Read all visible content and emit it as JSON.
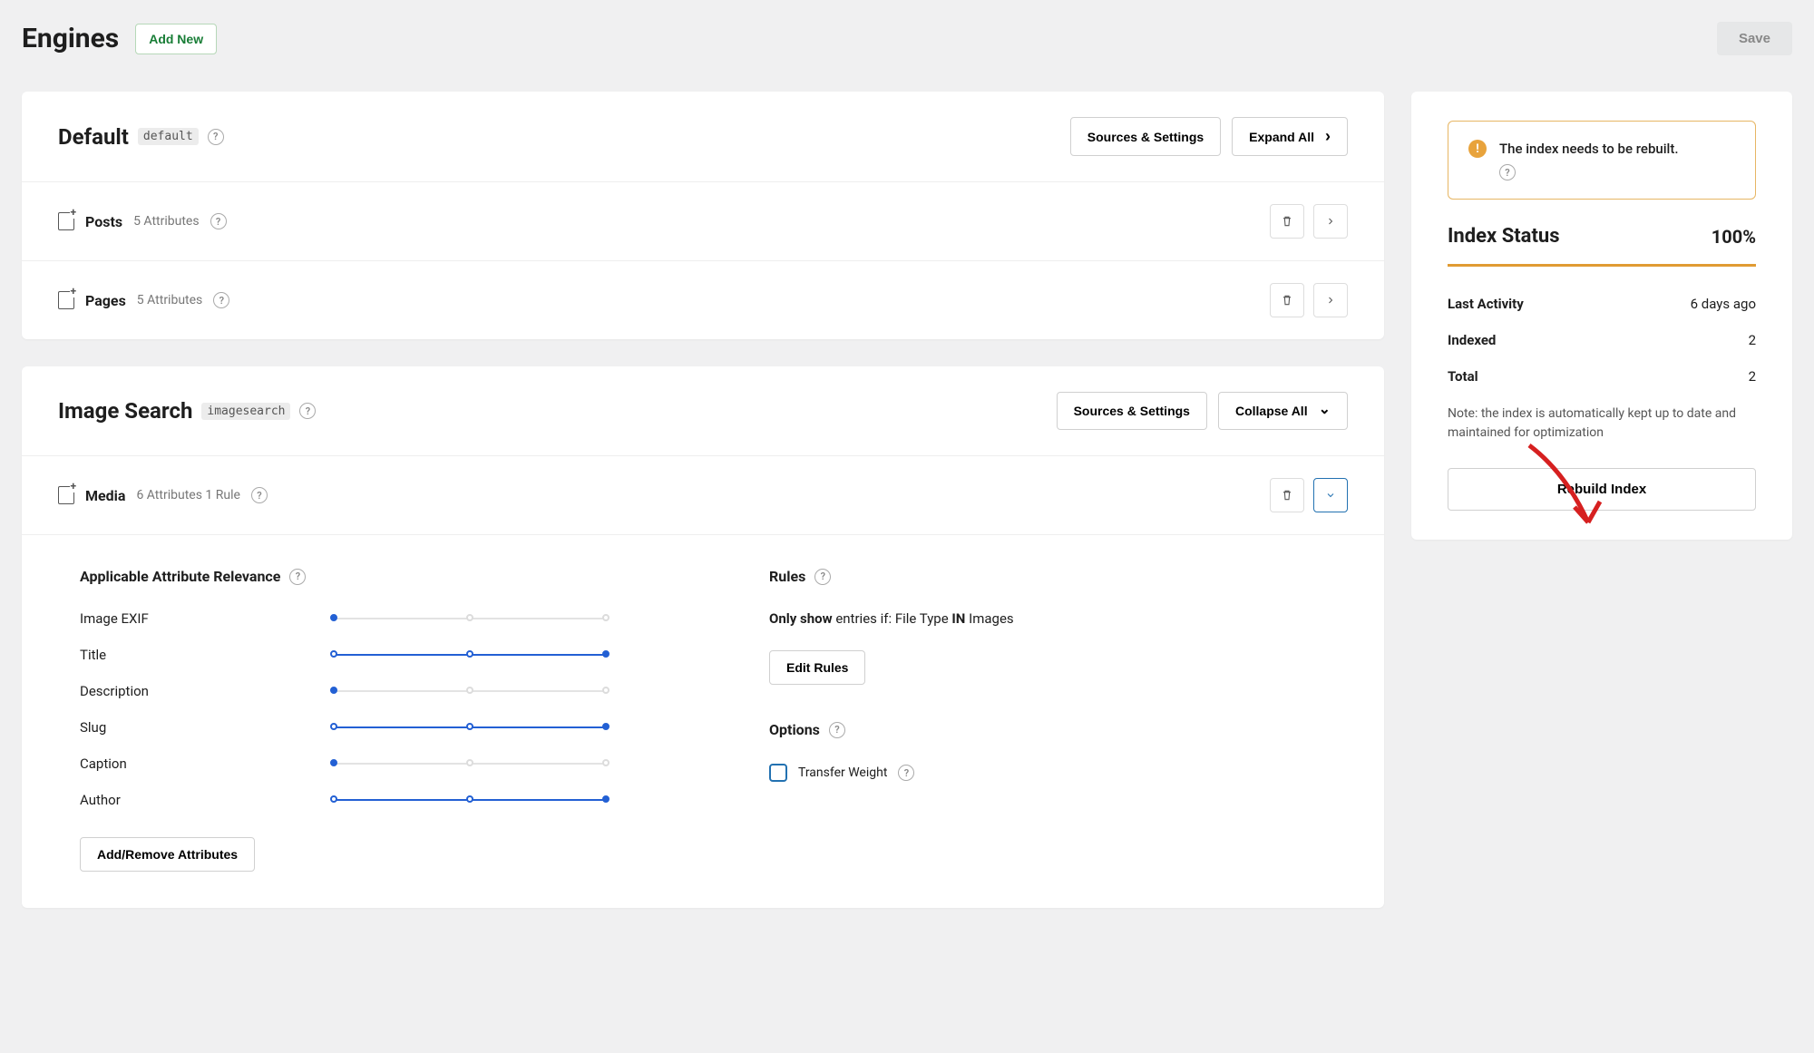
{
  "header": {
    "title": "Engines",
    "add_new": "Add New",
    "save": "Save"
  },
  "engines": [
    {
      "name": "Default",
      "slug": "default",
      "actions": {
        "sources": "Sources & Settings",
        "toggle": "Expand All"
      },
      "sources": [
        {
          "title": "Posts",
          "meta": "5 Attributes"
        },
        {
          "title": "Pages",
          "meta": "5 Attributes"
        }
      ]
    },
    {
      "name": "Image Search",
      "slug": "imagesearch",
      "actions": {
        "sources": "Sources & Settings",
        "toggle": "Collapse All"
      },
      "sources": [
        {
          "title": "Media",
          "meta": "6 Attributes 1 Rule"
        }
      ],
      "expanded": {
        "attr_title": "Applicable Attribute Relevance",
        "attributes": [
          {
            "label": "Image EXIF",
            "value": 0
          },
          {
            "label": "Title",
            "value": 2
          },
          {
            "label": "Description",
            "value": 0
          },
          {
            "label": "Slug",
            "value": 2
          },
          {
            "label": "Caption",
            "value": 0
          },
          {
            "label": "Author",
            "value": 2
          }
        ],
        "add_remove": "Add/Remove Attributes",
        "rules_title": "Rules",
        "rule_prefix": "Only show",
        "rule_mid": " entries if: File Type ",
        "rule_op": "IN",
        "rule_suffix": " Images",
        "edit_rules": "Edit Rules",
        "options_title": "Options",
        "transfer_weight": "Transfer Weight"
      }
    }
  ],
  "sidebar": {
    "alert": "The index needs to be rebuilt.",
    "status_title": "Index Status",
    "percent": "100%",
    "last_activity_label": "Last Activity",
    "last_activity_value": "6 days ago",
    "indexed_label": "Indexed",
    "indexed_value": "2",
    "total_label": "Total",
    "total_value": "2",
    "note": "Note: the index is automatically kept up to date and maintained for optimization",
    "rebuild": "Rebuild Index"
  }
}
